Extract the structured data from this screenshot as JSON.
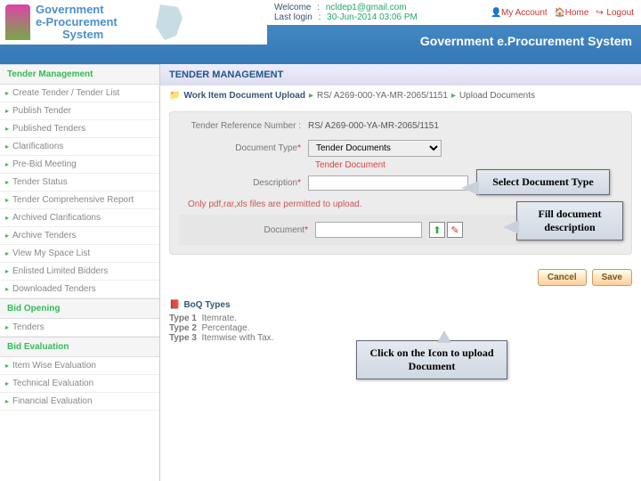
{
  "header": {
    "logo_line1": "Government",
    "logo_line2": "e-Procurement",
    "logo_line3": "System",
    "welcome_label": "Welcome",
    "welcome_value": "ncldep1@gmail.com",
    "lastlogin_label": "Last login",
    "lastlogin_value": "30-Jun-2014 03:06 PM",
    "account_links": {
      "myaccount": "My Account",
      "home": "Home",
      "logout": "Logout"
    },
    "system_title": "Government e.Procurement System"
  },
  "sidebar": {
    "groups": [
      {
        "head": "Tender Management",
        "items": [
          "Create Tender / Tender List",
          "Publish Tender",
          "Published Tenders",
          "Clarifications",
          "Pre-Bid Meeting",
          "Tender Status",
          "Tender Comprehensive Report",
          "Archived Clarifications",
          "Archive Tenders",
          "View My Space List",
          "Enlisted Limited Bidders",
          "Downloaded Tenders"
        ]
      },
      {
        "head": "Bid Opening",
        "items": [
          "Tenders"
        ]
      },
      {
        "head": "Bid Evaluation",
        "items": [
          "Item Wise Evaluation",
          "Technical Evaluation",
          "Financial Evaluation"
        ]
      }
    ]
  },
  "page": {
    "title": "TENDER MANAGEMENT",
    "breadcrumb": {
      "label": "Work Item Document Upload",
      "mid": "RS/ A269-000-YA-MR-2065/1151",
      "tail": "Upload Documents"
    }
  },
  "form": {
    "ref_label": "Tender Reference Number :",
    "ref_value": "RS/ A269-000-YA-MR-2065/1151",
    "doctype_label": "Document Type",
    "doctype_value": "Tender Documents",
    "doctype_sub": "Tender Document",
    "desc_label": "Description",
    "desc_value": "",
    "upload_note": "Only pdf,rar,xls files are permitted to upload.",
    "doc_label": "Document",
    "cancel": "Cancel",
    "save": "Save"
  },
  "boq": {
    "head": "BoQ Types",
    "rows": [
      {
        "t": "Type 1",
        "d": "Itemrate."
      },
      {
        "t": "Type 2",
        "d": "Percentage."
      },
      {
        "t": "Type 3",
        "d": "Itemwise with Tax."
      }
    ]
  },
  "callouts": {
    "c1": "Select Document Type",
    "c2": "Fill document description",
    "c3": "Click on the Icon to upload Document"
  }
}
